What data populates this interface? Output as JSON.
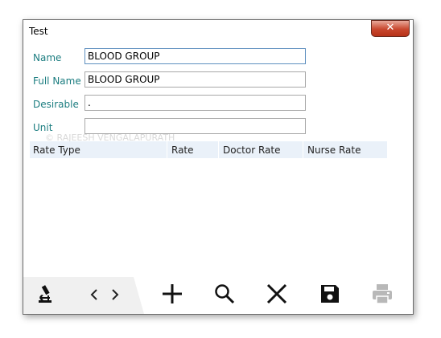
{
  "window": {
    "title": "Test",
    "close_glyph": "✕"
  },
  "form": {
    "name_label": "Name",
    "name_value": "BLOOD GROUP",
    "fullname_label": "Full Name",
    "fullname_value": "BLOOD GROUP",
    "desirable_label": "Desirable",
    "desirable_value": ".",
    "unit_label": "Unit",
    "unit_value": ""
  },
  "watermark": "© RAJEESH VENGALAPURATH",
  "grid": {
    "columns": [
      "Rate Type",
      "Rate",
      "Doctor Rate",
      "Nurse Rate"
    ]
  },
  "toolbar": {
    "icons": [
      "microscope-icon",
      "prev-icon",
      "next-icon",
      "add-icon",
      "search-icon",
      "delete-icon",
      "save-icon",
      "print-icon"
    ],
    "print_disabled_color": "#b8b8b8"
  }
}
